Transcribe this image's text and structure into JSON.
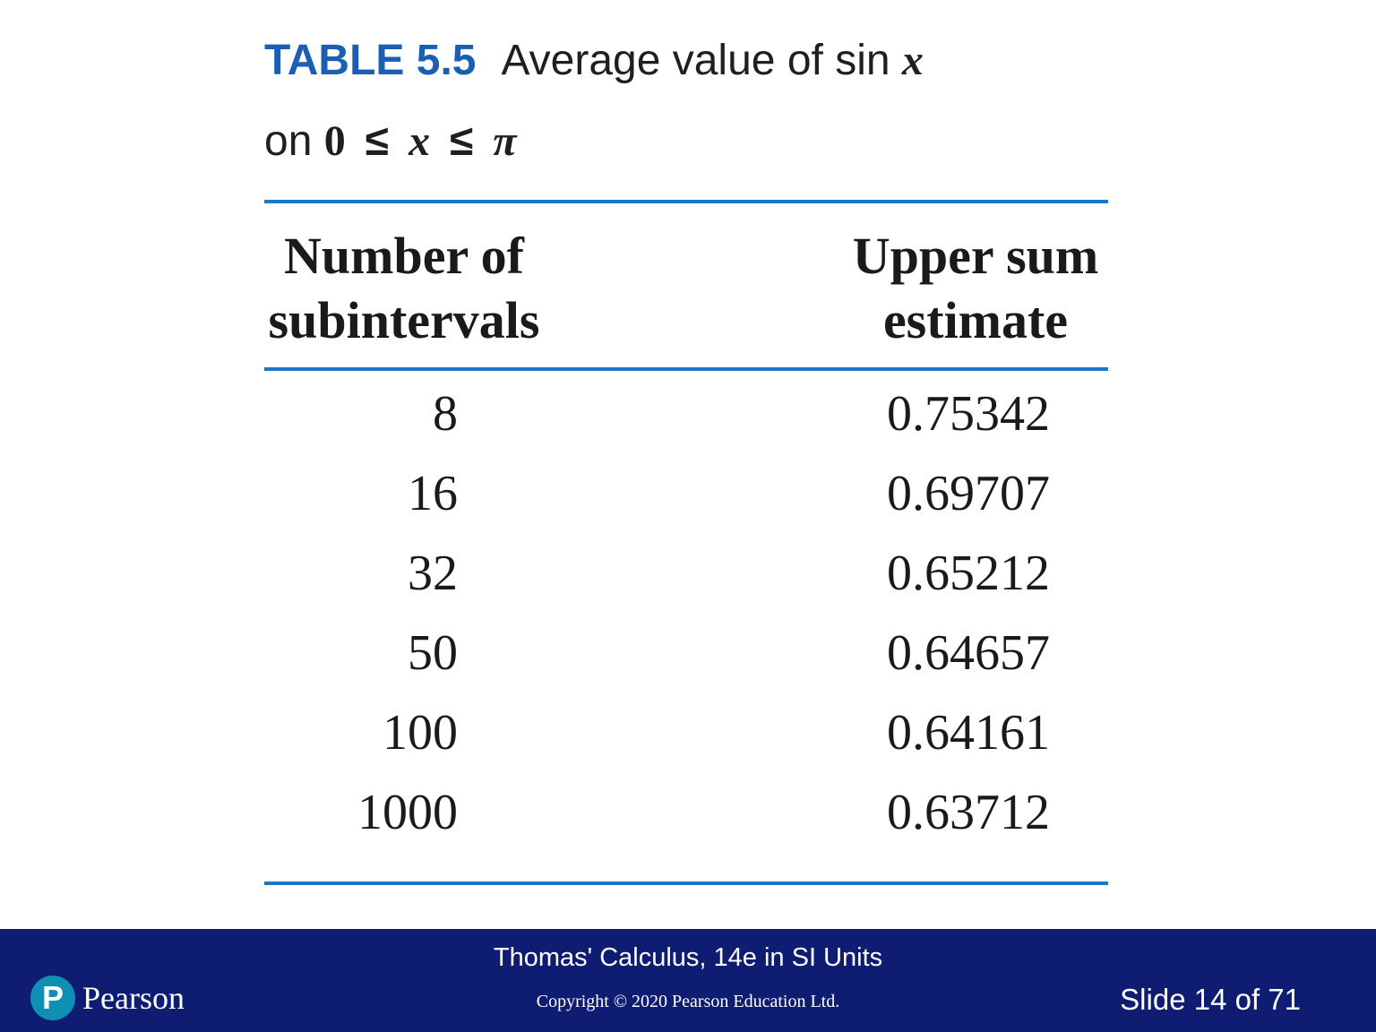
{
  "title": {
    "label": "TABLE 5.5",
    "text": "Average value of sin",
    "var": "x"
  },
  "subtitle": {
    "prefix": "on",
    "lower": "0",
    "op1": "≤",
    "var": "x",
    "op2": "≤",
    "upper": "π"
  },
  "table": {
    "headers": {
      "col1_line1": "Number of",
      "col1_line2": "subintervals",
      "col2_line1": "Upper sum",
      "col2_line2": "estimate"
    },
    "rows": [
      {
        "n": "8",
        "estimate": "0.75342"
      },
      {
        "n": "16",
        "estimate": "0.69707"
      },
      {
        "n": "32",
        "estimate": "0.65212"
      },
      {
        "n": "50",
        "estimate": "0.64657"
      },
      {
        "n": "100",
        "estimate": "0.64161"
      },
      {
        "n": "1000",
        "estimate": "0.63712"
      }
    ]
  },
  "footer": {
    "book": "Thomas' Calculus, 14e in SI Units",
    "copyright": "Copyright © 2020 Pearson Education Ltd.",
    "slide": "Slide 14 of 71",
    "logo_letter": "P",
    "logo_text": "Pearson",
    "background_color": "#0e1c72"
  },
  "accent_color": "#1b78c8",
  "logo_icon": "pearson-logo-icon"
}
